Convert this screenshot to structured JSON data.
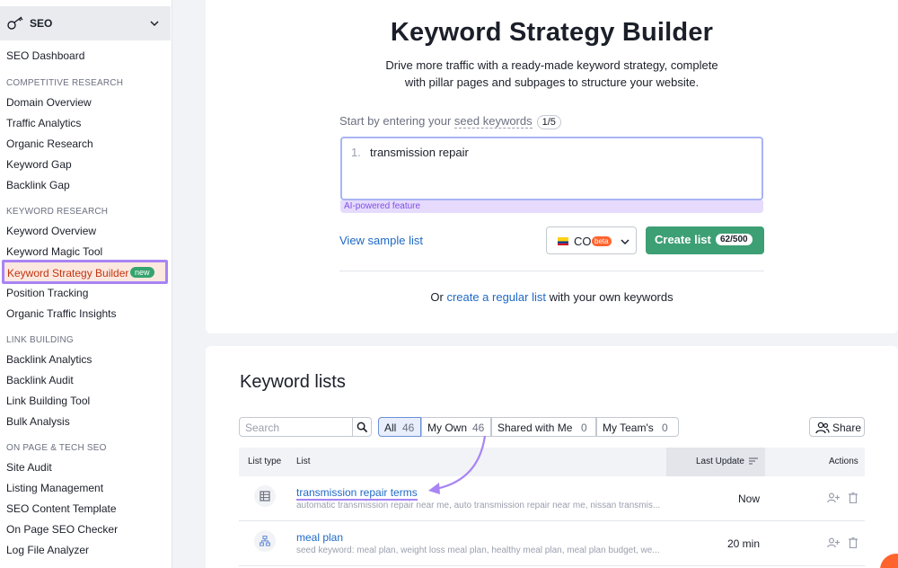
{
  "sidebar": {
    "header": "SEO",
    "items": {
      "seo_dashboard": "SEO Dashboard",
      "domain_overview": "Domain Overview",
      "traffic_analytics": "Traffic Analytics",
      "organic_research": "Organic Research",
      "keyword_gap": "Keyword Gap",
      "backlink_gap": "Backlink Gap",
      "keyword_overview": "Keyword Overview",
      "keyword_magic_tool": "Keyword Magic Tool",
      "keyword_strategy_builder": "Keyword Strategy Builder",
      "position_tracking": "Position Tracking",
      "organic_traffic_insights": "Organic Traffic Insights",
      "backlink_analytics": "Backlink Analytics",
      "backlink_audit": "Backlink Audit",
      "link_building_tool": "Link Building Tool",
      "bulk_analysis": "Bulk Analysis",
      "site_audit": "Site Audit",
      "listing_management": "Listing Management",
      "seo_content_template": "SEO Content Template",
      "on_page_seo_checker": "On Page SEO Checker",
      "log_file_analyzer": "Log File Analyzer"
    },
    "sections": {
      "competitive_research": "COMPETITIVE RESEARCH",
      "keyword_research": "KEYWORD RESEARCH",
      "link_building": "LINK BUILDING",
      "on_page_tech_seo": "ON PAGE & TECH SEO"
    },
    "new_badge": "new"
  },
  "builder": {
    "title": "Keyword Strategy Builder",
    "description_line1": "Drive more traffic with a ready-made keyword strategy, complete",
    "description_line2": "with pillar pages and subpages to structure your website.",
    "seed_prefix": "Start by entering your ",
    "seed_link": "seed keywords",
    "seed_count": "1/5",
    "input_number": "1.",
    "input_value": "transmission repair",
    "ai_feature": "AI-powered feature",
    "view_sample": "View sample list",
    "database_code": "CO",
    "beta_badge": "beta",
    "create_label": "Create list",
    "create_count": "62/500",
    "or_prefix": "Or ",
    "or_link": "create a regular list",
    "or_suffix": " with your own keywords"
  },
  "keyword_lists": {
    "title": "Keyword lists",
    "search_placeholder": "Search",
    "filters": [
      {
        "label": "All",
        "count": "46"
      },
      {
        "label": "My Own",
        "count": "46"
      },
      {
        "label": "Shared with Me",
        "count": "0"
      },
      {
        "label": "My Team's",
        "count": "0"
      }
    ],
    "share_label": "Share",
    "columns": {
      "list_type": "List type",
      "list": "List",
      "last_update": "Last Update",
      "actions": "Actions"
    },
    "rows": [
      {
        "name": "transmission repair terms",
        "keywords": "automatic transmission repair near me, auto transmission repair near me, nissan transmis...",
        "last_update": "Now",
        "icon": "table-icon"
      },
      {
        "name": "meal plan",
        "keywords": "seed keyword: meal plan, weight loss meal plan, healthy meal plan, meal plan budget, we...",
        "last_update": "20 min",
        "icon": "sitemap-icon"
      }
    ]
  },
  "colors": {
    "accent_green": "#3d9f74",
    "link_blue": "#1f69c6",
    "highlight_purple": "#a884f4",
    "active_orange": "#c2350f"
  }
}
